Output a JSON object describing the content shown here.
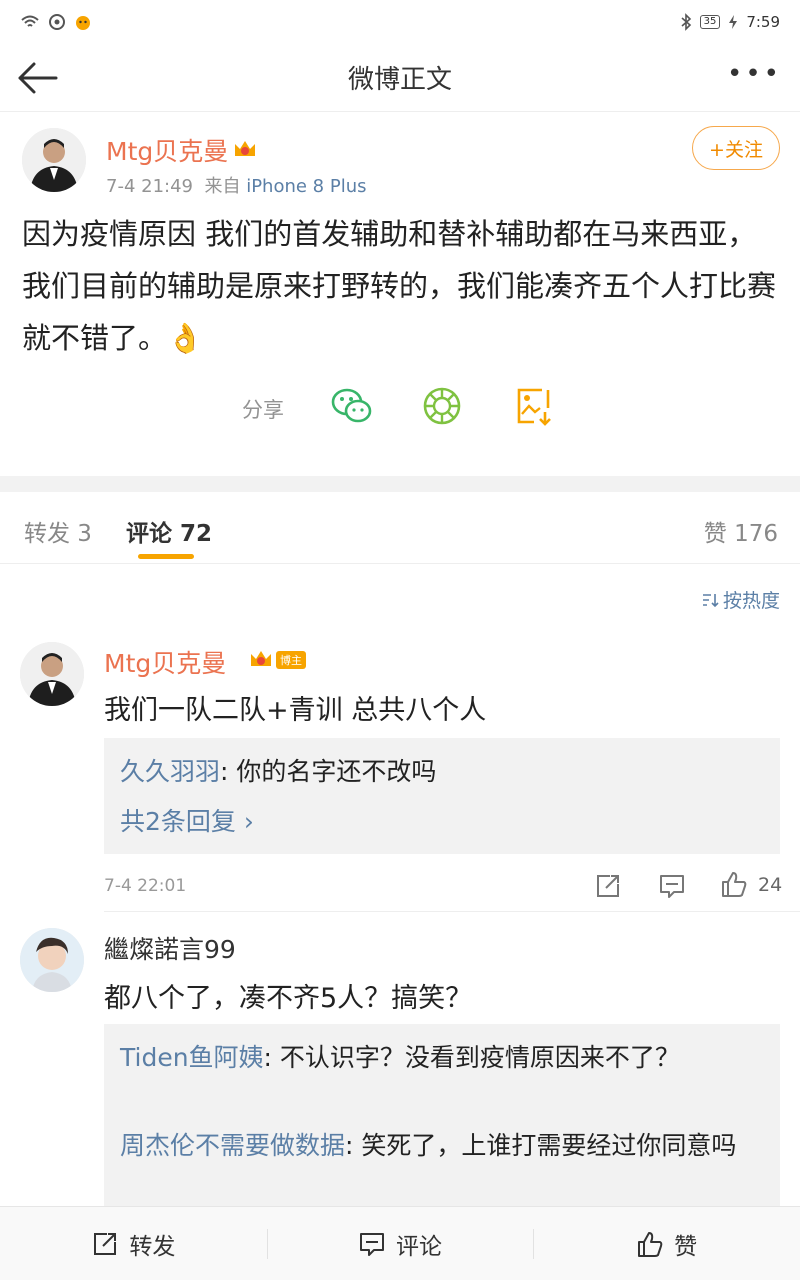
{
  "status_bar": {
    "time": "7:59",
    "battery": "35"
  },
  "nav": {
    "title": "微博正文"
  },
  "post": {
    "username": "Mtg贝克曼",
    "time": "7-4 21:49",
    "source_prefix": "来自",
    "device": "iPhone 8 Plus",
    "follow_label": "+关注",
    "text": "因为疫情原因 我们的首发辅助和替补辅助都在马来西亚，我们目前的辅助是原来打野转的，我们能凑齐五个人打比赛就不错了。",
    "emoji": "👌",
    "share_label": "分享"
  },
  "tabs": {
    "repost": "转发 3",
    "comments": "评论 72",
    "likes": "赞 176"
  },
  "sort_label": "按热度",
  "comments": [
    {
      "username": "Mtg贝克曼",
      "badge": "博主",
      "text": "我们一队二队+青训 总共八个人",
      "reply_name": "久久羽羽",
      "reply_text": ": 你的名字还不改吗",
      "more_replies": "共2条回复 ›",
      "time": "7-4 22:01",
      "likes": "24"
    },
    {
      "username": "繼燦諾言99",
      "text": "都八个了，凑不齐5人？搞笑？",
      "replies": [
        {
          "name": "Tiden鱼阿姨",
          "text": ": 不认识字？没看到疫情原因来不了？"
        },
        {
          "name": "周杰伦不需要做数据",
          "text": ": 笑死了，上谁打需要经过你同意吗"
        }
      ]
    }
  ],
  "bottom_bar": {
    "repost": "转发",
    "comment": "评论",
    "like": "赞"
  },
  "colors": {
    "accent": "#f08a00",
    "username": "#eb7350",
    "link": "#5b7fa6",
    "wechat": "#38b569"
  }
}
